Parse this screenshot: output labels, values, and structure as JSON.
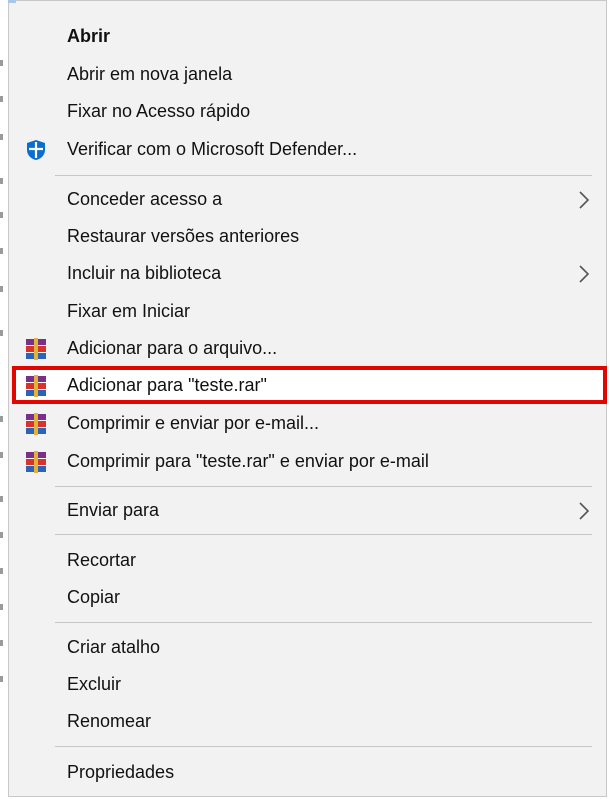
{
  "menu": {
    "items": [
      {
        "label": "Abrir",
        "bold": true
      },
      {
        "label": "Abrir em nova janela"
      },
      {
        "label": "Fixar no Acesso rápido"
      },
      {
        "label": "Verificar com o Microsoft Defender...",
        "icon": "defender-shield-icon"
      },
      {
        "label": "Conceder acesso a",
        "submenu": true
      },
      {
        "label": "Restaurar versões anteriores"
      },
      {
        "label": "Incluir na biblioteca",
        "submenu": true
      },
      {
        "label": "Fixar em Iniciar"
      },
      {
        "label": "Adicionar para o arquivo...",
        "icon": "winrar-icon"
      },
      {
        "label": "Adicionar para \"teste.rar\"",
        "icon": "winrar-icon",
        "highlighted": true
      },
      {
        "label": "Comprimir e enviar por e-mail...",
        "icon": "winrar-icon"
      },
      {
        "label": "Comprimir para \"teste.rar\" e enviar por e-mail",
        "icon": "winrar-icon"
      },
      {
        "label": "Enviar para",
        "submenu": true
      },
      {
        "label": "Recortar"
      },
      {
        "label": "Copiar"
      },
      {
        "label": "Criar atalho"
      },
      {
        "label": "Excluir"
      },
      {
        "label": "Renomear"
      },
      {
        "label": "Propriedades"
      }
    ]
  },
  "colors": {
    "menu_background": "#f2f2f2",
    "highlight_border": "#e10600",
    "defender_blue": "#0a6ed1"
  }
}
